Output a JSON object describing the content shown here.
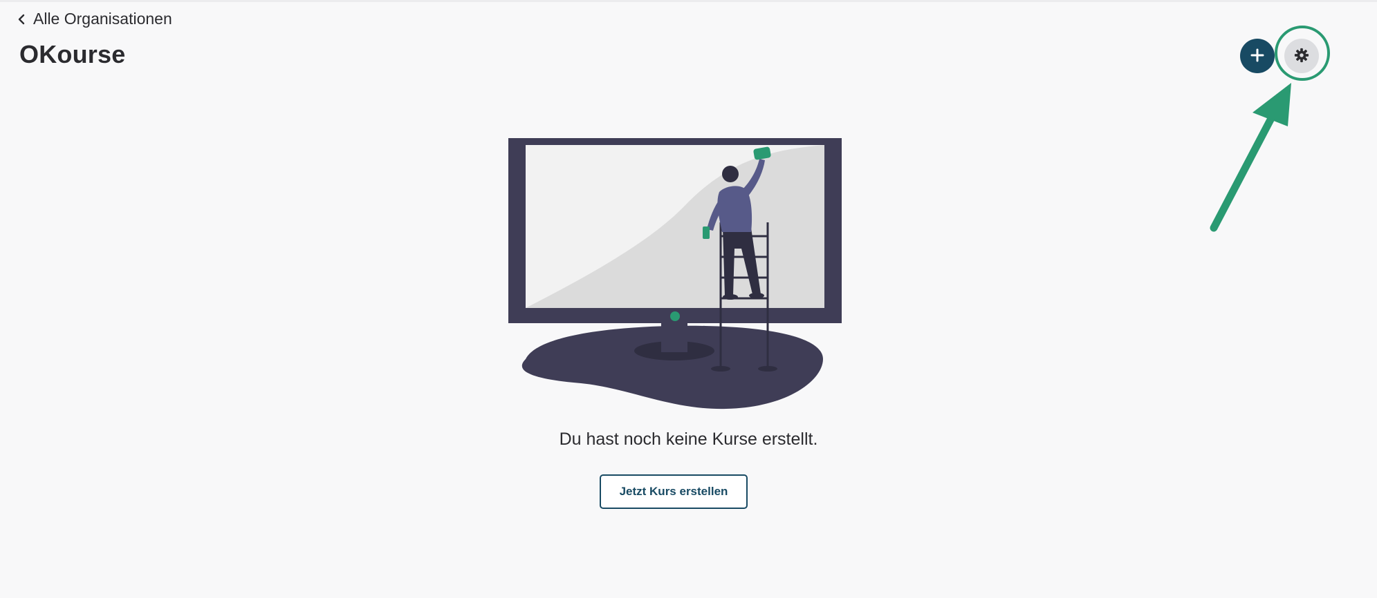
{
  "header": {
    "back_label": "Alle Organisationen",
    "title": "OKourse"
  },
  "actions": {
    "add_icon": "plus-icon",
    "settings_icon": "gear-icon"
  },
  "empty_state": {
    "message": "Du hast noch keine Kurse erstellt.",
    "cta_label": "Jetzt Kurs erstellen"
  },
  "colors": {
    "background": "#f8f8f9",
    "primary": "#184a63",
    "highlight": "#2a9a72",
    "illustration_dark": "#3f3d56",
    "illustration_accent": "#2a9a72"
  }
}
